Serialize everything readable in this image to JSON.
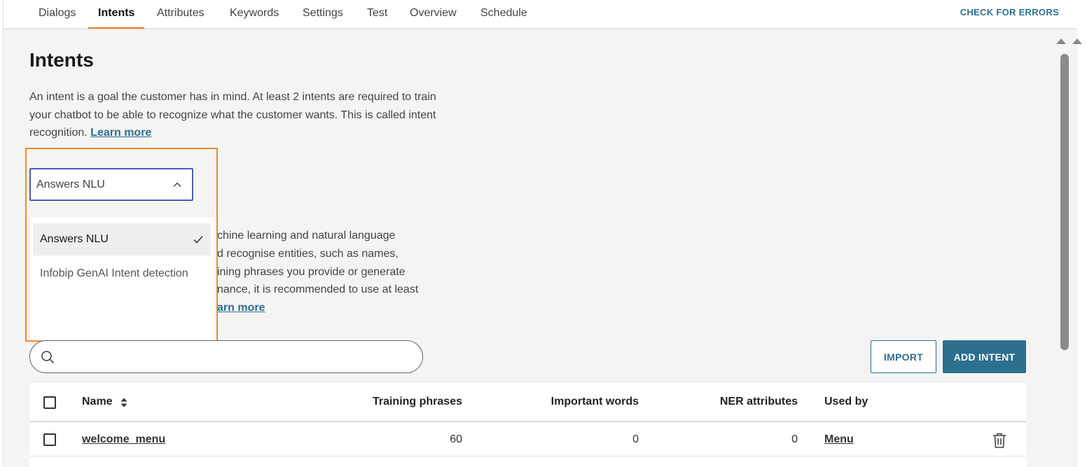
{
  "nav": {
    "tabs": [
      "Dialogs",
      "Intents",
      "Attributes",
      "Keywords",
      "Settings",
      "Test",
      "Overview",
      "Schedule"
    ],
    "active_tab": "Intents",
    "check_errors": "CHECK FOR ERRORS"
  },
  "page": {
    "title": "Intents",
    "description": "An intent is a goal the customer has in mind. At least 2 intents are required to train your chatbot to be able to recognize what the customer wants. This is called intent recognition.",
    "learn_more": "Learn more"
  },
  "engine_select": {
    "value": "Answers NLU",
    "options": [
      {
        "label": "Answers NLU",
        "selected": true
      },
      {
        "label": "Infobip GenAI Intent detection",
        "selected": false
      }
    ]
  },
  "obscured_text": {
    "lines": [
      "chine learning and natural language",
      "d recognise entities, such as names,",
      "ining phrases you provide or generate",
      "nance, it is recommended to use at least"
    ],
    "link": "arn more"
  },
  "search": {
    "placeholder": ""
  },
  "buttons": {
    "import": "IMPORT",
    "add_intent": "ADD INTENT"
  },
  "table": {
    "headers": {
      "name": "Name",
      "training_phrases": "Training phrases",
      "important_words": "Important words",
      "ner_attributes": "NER attributes",
      "used_by": "Used by"
    },
    "rows": [
      {
        "name": "welcome_menu",
        "training_phrases": "60",
        "important_words": "0",
        "ner_attributes": "0",
        "used_by": "Menu"
      }
    ]
  },
  "colors": {
    "accent": "#2d6f8f",
    "tab_underline": "#e8742c",
    "highlight_frame": "#f08a28",
    "select_border": "#4b5db8"
  }
}
